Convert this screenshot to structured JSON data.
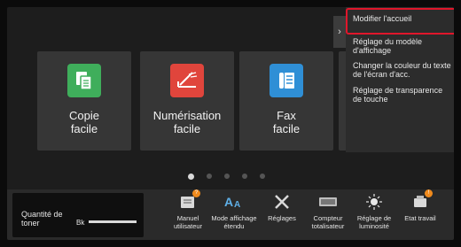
{
  "tiles": [
    {
      "label_line1": "Copie",
      "label_line2": "facile",
      "icon": "copy-icon",
      "color": "#3fae5b"
    },
    {
      "label_line1": "Numérisation",
      "label_line2": "facile",
      "icon": "scan-icon",
      "color": "#e0453c"
    },
    {
      "label_line1": "Fax",
      "label_line2": "facile",
      "icon": "fax-icon",
      "color": "#2f8fd6"
    }
  ],
  "pager": {
    "total": 5,
    "active": 1
  },
  "panel": {
    "toggle_glyph": "›",
    "items": [
      "Modifier l'accueil",
      "Réglage du modèle d'affichage",
      "Changer la couleur du texte de l'écran d'acc.",
      "Réglage de transparence de touche"
    ],
    "highlight_color": "#e0162b"
  },
  "toner": {
    "label": "Quantité de toner",
    "color_label": "Bk",
    "level_fraction": 1.0
  },
  "bottom_items": [
    {
      "label": "Manuel utilisateur",
      "icon": "manual-icon",
      "badge": "?"
    },
    {
      "label": "Mode affichage étendu",
      "icon": "enlarge-text-icon"
    },
    {
      "label": "Réglages",
      "icon": "settings-tools-icon"
    },
    {
      "label": "Compteur totalisateur",
      "icon": "counter-icon"
    },
    {
      "label": "Réglage de luminosité",
      "icon": "brightness-icon"
    },
    {
      "label": "Etat travail",
      "icon": "job-status-icon",
      "badge": "!"
    }
  ]
}
